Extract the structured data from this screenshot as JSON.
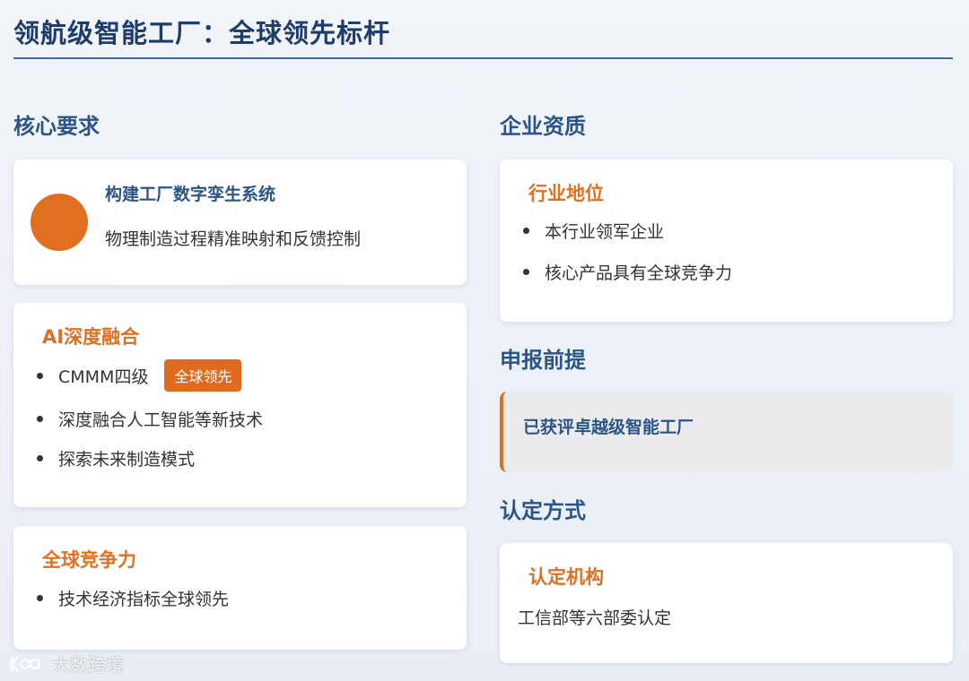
{
  "header": {
    "title": "领航级智能工厂：全球领先标杆"
  },
  "left": {
    "heading": "核心要求",
    "card1": {
      "title": "构建工厂数字孪生系统",
      "text": "物理制造过程精准映射和反馈控制"
    },
    "card2": {
      "title": "AI深度融合",
      "items": [
        "CMMM四级",
        "深度融合人工智能等新技术",
        "探索未来制造模式"
      ],
      "badge": "全球领先"
    },
    "card3": {
      "title": "全球竞争力",
      "items": [
        "技术经济指标全球领先"
      ]
    }
  },
  "right": {
    "heading1": "企业资质",
    "card1": {
      "title": "行业地位",
      "items": [
        "本行业领军企业",
        "核心产品具有全球竞争力"
      ]
    },
    "heading2": "申报前提",
    "callout": {
      "text": "已获评卓越级智能工厂"
    },
    "heading3": "认定方式",
    "card2": {
      "title": "认定机构",
      "text": "工信部等六部委认定"
    }
  },
  "watermark": {
    "text": "大数跨境"
  },
  "colors": {
    "accent": "#e07020",
    "heading": "#2b5587",
    "title": "#1f3d6b"
  }
}
